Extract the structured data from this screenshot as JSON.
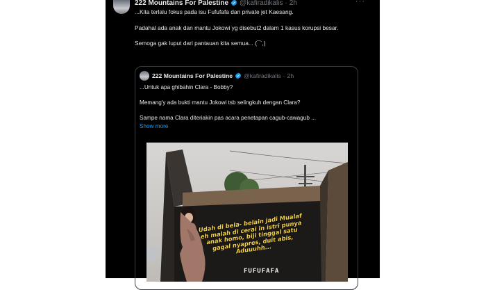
{
  "tweet": {
    "author_name": "222 Mountains For Palestine",
    "handle": "@kafiradikalis",
    "separator": "·",
    "time": "2h",
    "more_glyph": "···",
    "lines": [
      "...Kita terlalu fokus pada isu Fufufafa dan private jet Kaesang.",
      "Padahal ada anak dan mantu Jokowi yg disebut2 dalam 1 kasus korupsi besar.",
      "Semoga gak luput dari pantauan kita semua... (¯`,)"
    ]
  },
  "quote": {
    "author_name": "222 Mountains For Palestine",
    "handle": "@kafiradikalis",
    "separator": "·",
    "time": "2h",
    "lines": [
      "...Untuk apa ghibahin Clara - Bobby?",
      "Memang'y ada bukti mantu Jokowi tsb selingkuh dengan Clara?",
      "Sampe nama Clara diteriakin pas acara penetapan cagub-cawagub ..."
    ],
    "show_more": "Show more",
    "image": {
      "overlay_text": "Udah di bela- belain jadi Mualaf eh malah di cerai in istri punya anak homo, biji tinggal satu gagal nyapres, duit abis, Aduuuhh...",
      "brand_text": "FUFUFAFA"
    }
  },
  "colors": {
    "background": "#000000",
    "text": "#e7e9ea",
    "muted": "#71767b",
    "link": "#1d9bf0",
    "verified": "#1d9bf0",
    "border": "#3a3d41"
  }
}
